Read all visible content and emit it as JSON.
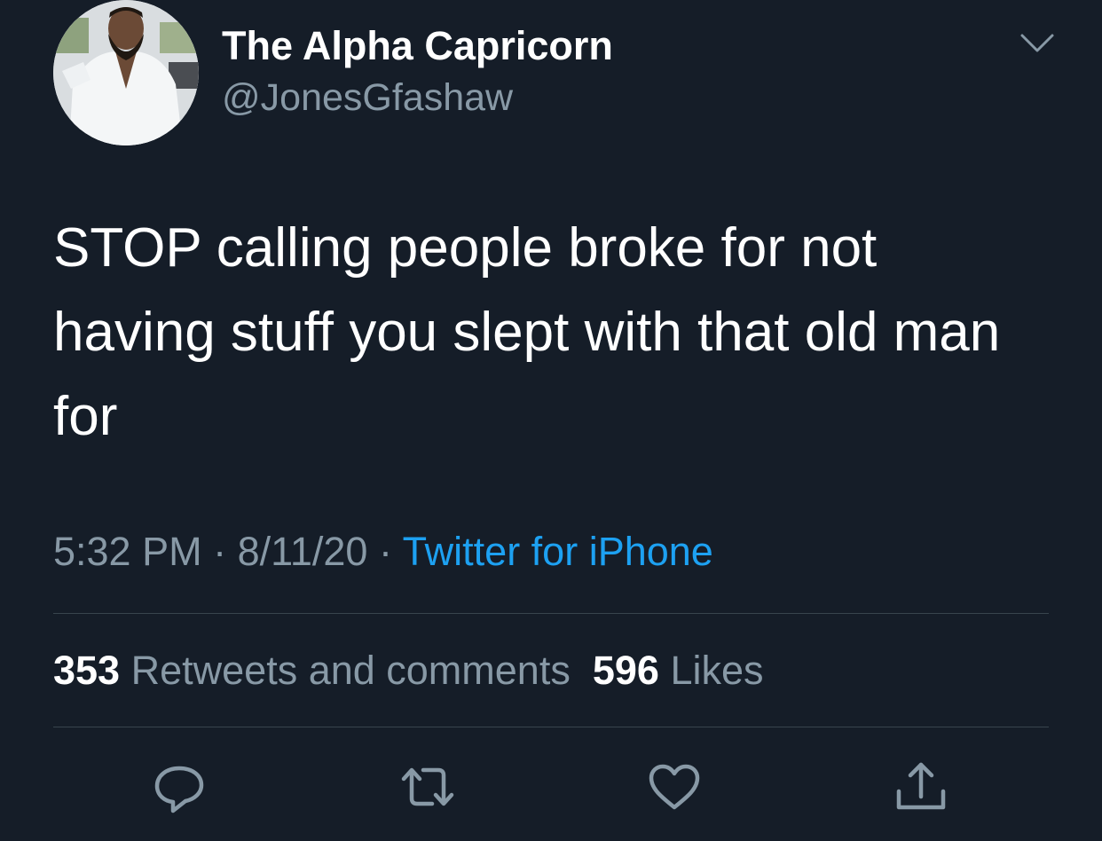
{
  "tweet": {
    "author": {
      "display_name": "The Alpha Capricorn",
      "handle": "@JonesGfashaw"
    },
    "text": "STOP calling people broke for not having stuff you slept with that old man for",
    "time": "5:32 PM",
    "date": "8/11/20",
    "separator": "·",
    "source": "Twitter for iPhone",
    "stats": {
      "retweets_count": "353",
      "retweets_label": "Retweets and comments",
      "likes_count": "596",
      "likes_label": "Likes"
    }
  },
  "icons": {
    "menu": "chevron-down-icon",
    "reply": "reply-icon",
    "retweet": "retweet-icon",
    "like": "heart-icon",
    "share": "share-icon"
  },
  "colors": {
    "background": "#151d28",
    "text_primary": "#ffffff",
    "text_secondary": "#8899a6",
    "accent": "#1da1f2",
    "divider": "#38444d"
  }
}
